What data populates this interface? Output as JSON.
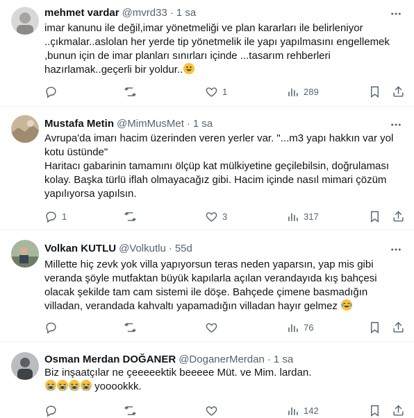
{
  "tweets": [
    {
      "name": "mehmet vardar",
      "handle": "@mvrd33",
      "dot": "·",
      "time": "1 sa",
      "lines": [
        "imar kanunu ile değil,imar yönetmeliği ve plan kararları ile belirleniyor",
        "..çıkmalar..aslolan her yerde tip yönetmelik ile yapı yapılmasını engellemek",
        ",bunun için de imar planları sınırları içinde ...tasarım rehberleri",
        "hazırlamak..geçerli bir yoldur.."
      ],
      "trailing_emoji": "grinning-face",
      "reply_count": "",
      "retweet_count": "",
      "like_count": "1",
      "view_count": "289"
    },
    {
      "name": "Mustafa Metin",
      "handle": "@MimMusMet",
      "dot": "·",
      "time": "1 sa",
      "lines": [
        "Avrupa'da imarı hacim üzerinden veren yerler var. \"...m3 yapı hakkın var yol",
        "kotu üstünde\"",
        "Haritacı gabarinin tamamını ölçüp kat mülkiyetine geçilebilsin, doğrulaması",
        "kolay. Başka türlü iflah olmayacağız gibi. Hacim içinde nasıl mimari çözüm",
        "yapılıyorsa yapılsın."
      ],
      "reply_count": "1",
      "retweet_count": "",
      "like_count": "3",
      "view_count": "317"
    },
    {
      "name": "Volkan KUTLU",
      "handle": "@Volkutlu",
      "dot": "·",
      "time": "55d",
      "lines": [
        "Millette hiç zevk yok villa yapıyorsun teras neden yaparsın, yap mis gibi",
        "veranda şöyle mutfaktan büyük kapılarla açılan verandayıda kış bahçesi",
        "olacak şekilde tam cam sistemi ile döşe. Bahçede çimene basmadığın",
        "villadan, verandada kahvaltı yapamadığın villadan hayır gelmez"
      ],
      "trailing_emoji": "face-with-tears-of-joy",
      "reply_count": "",
      "retweet_count": "",
      "like_count": "",
      "view_count": "76"
    },
    {
      "name": "Osman Merdan DOĞANER",
      "handle": "@DoganerMerdan",
      "dot": "·",
      "time": "1 sa",
      "lines": [
        "Biz inşaatçılar ne çeeeeektik beeeee Müt. ve Mim. lardan.",
        "yooookkk."
      ],
      "leading_emojis": [
        "loudly-crying-face",
        "loudly-crying-face",
        "loudly-crying-face",
        "loudly-crying-face"
      ],
      "reply_count": "",
      "retweet_count": "",
      "like_count": "",
      "view_count": "142"
    }
  ],
  "colors": {
    "text": "#0f1419",
    "secondary": "#536471",
    "divider": "#eff3f4",
    "emoji_yellow": "#f7c23c"
  }
}
